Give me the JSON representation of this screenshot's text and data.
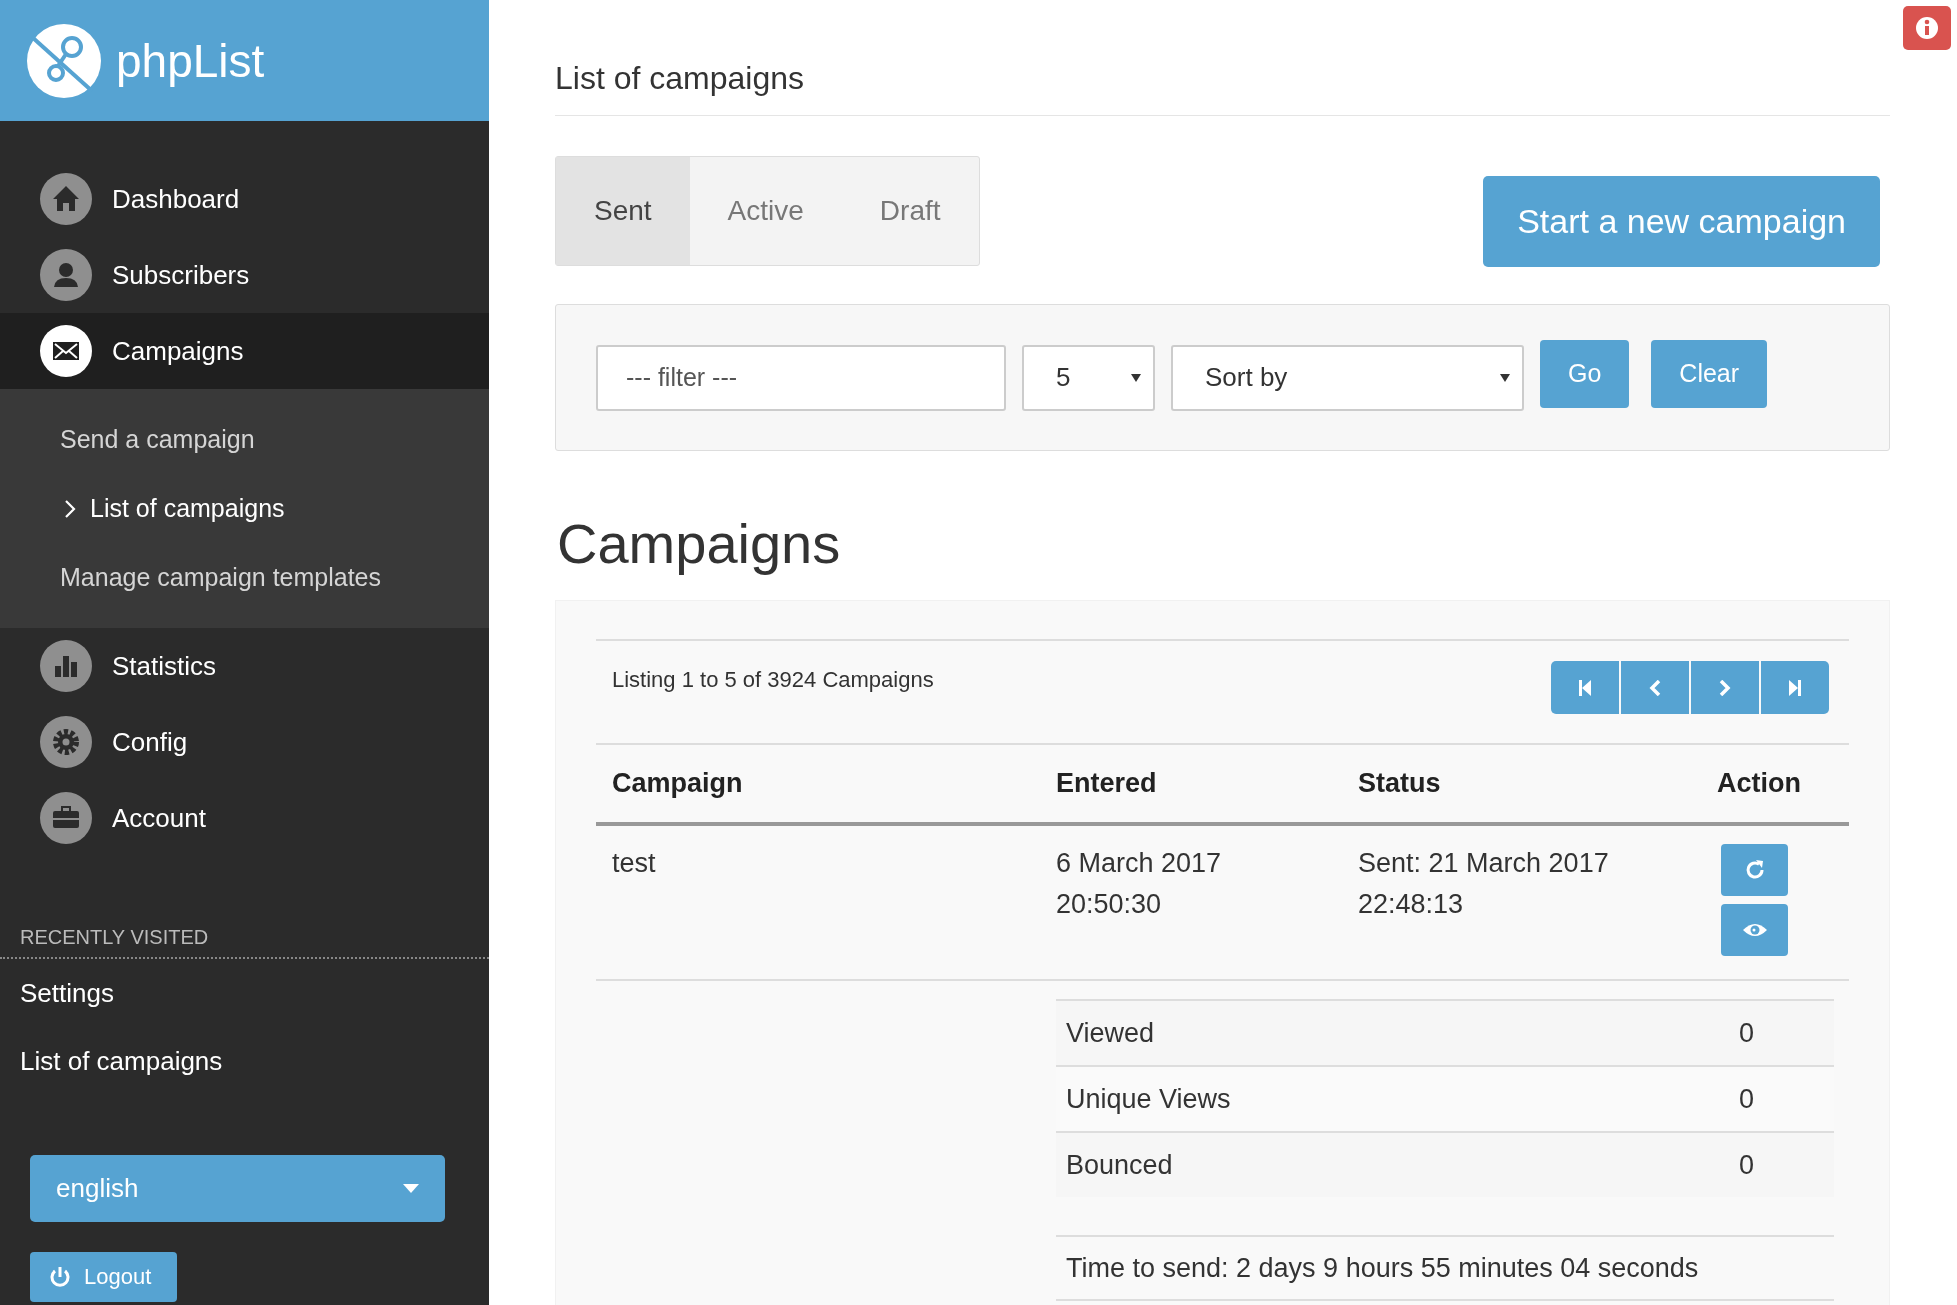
{
  "sidebar": {
    "logo": "phpList",
    "nav": [
      {
        "label": "Dashboard",
        "kind": "home",
        "selected": false
      },
      {
        "label": "Subscribers",
        "kind": "user",
        "selected": false
      },
      {
        "label": "Campaigns",
        "kind": "mail",
        "selected": true,
        "children": [
          {
            "label": "Send a campaign",
            "selected": false
          },
          {
            "label": "List of campaigns",
            "selected": true
          },
          {
            "label": "Manage campaign templates",
            "selected": false
          }
        ]
      },
      {
        "label": "Statistics",
        "kind": "chart",
        "selected": false
      },
      {
        "label": "Config",
        "kind": "gear",
        "selected": false
      },
      {
        "label": "Account",
        "kind": "briefcase",
        "selected": false
      }
    ],
    "recent": {
      "heading": "RECENTLY VISITED",
      "items": [
        "Settings",
        "List of campaigns"
      ]
    },
    "language": "english",
    "logout": "Logout"
  },
  "main": {
    "title": "List of campaigns",
    "tabs": [
      {
        "label": "Sent",
        "selected": true
      },
      {
        "label": "Active",
        "selected": false
      },
      {
        "label": "Draft",
        "selected": false
      }
    ],
    "new_campaign_button": "Start a new campaign",
    "filter": {
      "placeholder": "--- filter ---",
      "page_size": "5",
      "sort": "Sort by",
      "go": "Go",
      "clear": "Clear"
    },
    "heading": "Campaigns",
    "listing": "Listing 1 to 5 of 3924 Campaigns",
    "pager": [
      {
        "kind": "first"
      },
      {
        "kind": "prev"
      },
      {
        "kind": "next"
      },
      {
        "kind": "last"
      }
    ],
    "table": {
      "columns": [
        "Campaign",
        "Entered",
        "Status",
        "Action"
      ],
      "rows": [
        {
          "campaign": "test",
          "entered": [
            "6 March 2017",
            "20:50:30"
          ],
          "status": [
            "Sent: 21 March 2017",
            "22:48:13"
          ],
          "actions": [
            {
              "kind": "resend"
            },
            {
              "kind": "view"
            }
          ],
          "stats": [
            {
              "label": "Viewed",
              "value": "0"
            },
            {
              "label": "Unique Views",
              "value": "0"
            },
            {
              "label": "Bounced",
              "value": "0"
            }
          ],
          "time_to_send": "Time to send: 2 days 9 hours 55 minutes 04 seconds"
        }
      ]
    }
  }
}
